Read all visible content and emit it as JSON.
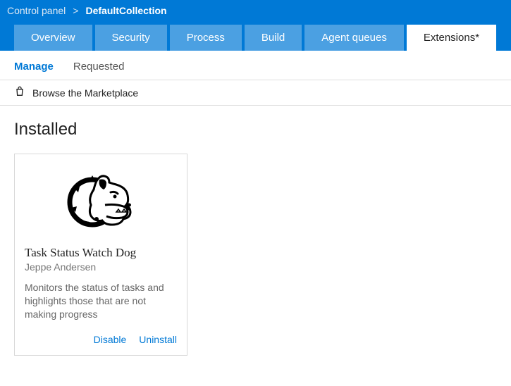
{
  "breadcrumb": {
    "root": "Control panel",
    "sep": ">",
    "current": "DefaultCollection"
  },
  "tabs": [
    {
      "label": "Overview",
      "active": false
    },
    {
      "label": "Security",
      "active": false
    },
    {
      "label": "Process",
      "active": false
    },
    {
      "label": "Build",
      "active": false
    },
    {
      "label": "Agent queues",
      "active": false
    },
    {
      "label": "Extensions*",
      "active": true
    }
  ],
  "subtabs": {
    "manage": "Manage",
    "requested": "Requested"
  },
  "marketplace_label": "Browse the Marketplace",
  "section_title": "Installed",
  "card": {
    "title": "Task Status Watch Dog",
    "author": "Jeppe Andersen",
    "description": "Monitors the status of tasks and highlights those that are not making progress",
    "actions": {
      "disable": "Disable",
      "uninstall": "Uninstall"
    }
  }
}
